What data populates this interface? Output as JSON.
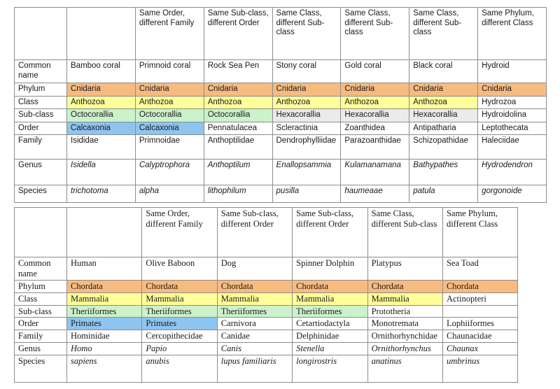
{
  "tables": [
    {
      "id": "corals",
      "name": "coral-taxonomy-table",
      "column_headers": [
        "",
        "",
        "Same Order, different Family",
        "Same Sub-class, different Order",
        "Same Class, different Sub-class",
        "Same Class, different Sub-class",
        "Same Class, different Sub-class",
        "Same Phylum, different Class"
      ],
      "row_labels": [
        "Common name",
        "Phylum",
        "Class",
        "Sub-class",
        "Order",
        "Family",
        "Genus",
        "Species"
      ],
      "rows": [
        {
          "label": "Common name",
          "key": "common",
          "italic": false,
          "cells": [
            "Bamboo coral",
            "Primnoid coral",
            "Rock Sea Pen",
            "Stony coral",
            "Gold coral",
            "Black coral",
            "Hydroid"
          ],
          "fills": [
            "none",
            "none",
            "none",
            "none",
            "none",
            "none",
            "none"
          ]
        },
        {
          "label": "Phylum",
          "key": "phylum",
          "italic": false,
          "cells": [
            "Cnidaria",
            "Cnidaria",
            "Cnidaria",
            "Cnidaria",
            "Cnidaria",
            "Cnidaria",
            "Cnidaria"
          ],
          "fills": [
            "phylum",
            "phylum",
            "phylum",
            "phylum",
            "phylum",
            "phylum",
            "phylum"
          ]
        },
        {
          "label": "Class",
          "key": "class",
          "italic": false,
          "cells": [
            "Anthozoa",
            "Anthozoa",
            "Anthozoa",
            "Anthozoa",
            "Anthozoa",
            "Anthozoa",
            "Hydrozoa"
          ],
          "fills": [
            "class",
            "class",
            "class",
            "class",
            "class",
            "class",
            "none"
          ]
        },
        {
          "label": "Sub-class",
          "key": "subclass",
          "italic": false,
          "cells": [
            "Octocorallia",
            "Octocorallia",
            "Octocorallia",
            "Hexacorallia",
            "Hexacorallia",
            "Hexacorallia",
            "Hydroidolina"
          ],
          "fills": [
            "subclass",
            "subclass",
            "subclass",
            "gray",
            "gray",
            "gray",
            "none"
          ]
        },
        {
          "label": "Order",
          "key": "order",
          "italic": false,
          "cells": [
            "Calcaxonia",
            "Calcaxonia",
            "Pennatulacea",
            "Scleractinia",
            "Zoanthidea",
            "Antipatharia",
            "Leptothecata"
          ],
          "fills": [
            "order",
            "order",
            "none",
            "none",
            "none",
            "none",
            "none"
          ]
        },
        {
          "label": "Family",
          "key": "family",
          "italic": false,
          "cells": [
            "Isididae",
            "Primnoidae",
            "Anthoptilidae",
            "Dendrophylliidae",
            "Parazoanthidae",
            "Schizopathidae",
            "Haleciidae"
          ],
          "fills": [
            "none",
            "none",
            "none",
            "none",
            "none",
            "none",
            "none"
          ]
        },
        {
          "label": "Genus",
          "key": "genus",
          "italic": true,
          "cells": [
            "Isidella",
            "Calyptrophora",
            "Anthoptilum",
            "Enallopsammia",
            "Kulamanamana",
            "Bathypathes",
            "Hydrodendron"
          ],
          "fills": [
            "none",
            "none",
            "none",
            "none",
            "none",
            "none",
            "none"
          ]
        },
        {
          "label": "Species",
          "key": "species",
          "italic": true,
          "cells": [
            "trichotoma",
            "alpha",
            "lithophilum",
            "pusilla",
            "haumeaae",
            "patula",
            "gorgonoide"
          ],
          "fills": [
            "none",
            "none",
            "none",
            "none",
            "none",
            "none",
            "none"
          ]
        }
      ]
    },
    {
      "id": "vertebrates",
      "name": "vertebrate-taxonomy-table",
      "column_headers": [
        "",
        "",
        "Same Order, different Family",
        "Same Sub-class, different Order",
        "Same Sub-class, different Order",
        "Same Class, different Sub-class",
        "Same Phylum, different Class"
      ],
      "row_labels": [
        "Common name",
        "Phylum",
        "Class",
        "Sub-class",
        "Order",
        "Family",
        "Genus",
        "Species"
      ],
      "rows": [
        {
          "label": "Common name",
          "key": "common",
          "italic": false,
          "cells": [
            "Human",
            "Olive Baboon",
            "Dog",
            "Spinner Dolphin",
            "Platypus",
            "Sea Toad"
          ],
          "fills": [
            "none",
            "none",
            "none",
            "none",
            "none",
            "none"
          ]
        },
        {
          "label": "Phylum",
          "key": "phylum",
          "italic": false,
          "cells": [
            "Chordata",
            "Chordata",
            "Chordata",
            "Chordata",
            "Chordata",
            "Chordata"
          ],
          "fills": [
            "phylum",
            "phylum",
            "phylum",
            "phylum",
            "phylum",
            "phylum"
          ]
        },
        {
          "label": "Class",
          "key": "class",
          "italic": false,
          "cells": [
            "Mammalia",
            "Mammalia",
            "Mammalia",
            "Mammalia",
            "Mammalia",
            "Actinopteri"
          ],
          "fills": [
            "class",
            "class",
            "class",
            "class",
            "class",
            "none"
          ]
        },
        {
          "label": "Sub-class",
          "key": "subclass",
          "italic": false,
          "cells": [
            "Theriiformes",
            "Theriiformes",
            "Theriiformes",
            "Theriiformes",
            "Prototheria",
            ""
          ],
          "fills": [
            "subclass",
            "subclass",
            "subclass",
            "subclass",
            "none",
            "none"
          ]
        },
        {
          "label": "Order",
          "key": "order",
          "italic": false,
          "cells": [
            "Primates",
            "Primates",
            "Carnivora",
            "Cetartiodactyla",
            "Monotremata",
            "Lophiiformes"
          ],
          "fills": [
            "order",
            "order",
            "none",
            "none",
            "none",
            "none"
          ]
        },
        {
          "label": "Family",
          "key": "family",
          "italic": false,
          "cells": [
            "Hominidae",
            "Cercopithecidae",
            "Canidae",
            "Delphinidae",
            "Ornithorhynchidae",
            "Chaunacidae"
          ],
          "fills": [
            "none",
            "none",
            "none",
            "none",
            "none",
            "none"
          ]
        },
        {
          "label": "Genus",
          "key": "genus",
          "italic": true,
          "cells": [
            "Homo",
            "Papio",
            "Canis",
            "Stenella",
            "Ornithorhynchus",
            "Chaunax"
          ],
          "fills": [
            "none",
            "none",
            "none",
            "none",
            "none",
            "none"
          ]
        },
        {
          "label": "Species",
          "key": "species",
          "italic": true,
          "cells": [
            "sapiens",
            "anubis",
            "lupus familiaris",
            "longirostris",
            "anatinus",
            "umbrinus"
          ],
          "fills": [
            "none",
            "none",
            "none",
            "none",
            "none",
            "none"
          ]
        }
      ]
    }
  ],
  "colors": {
    "phylum": "#f7bb80",
    "class": "#ffff99",
    "subclass": "#ccf2cc",
    "order": "#8ec4f0",
    "gray": "#ebebeb",
    "border": "#8c8c8c"
  }
}
